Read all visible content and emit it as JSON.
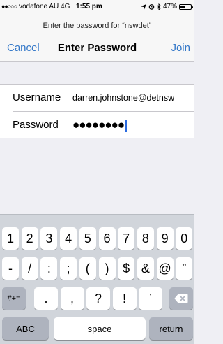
{
  "status": {
    "signal": "●●○○○",
    "carrier": "vodafone AU",
    "network": "4G",
    "time": "1:55 pm",
    "icons": [
      "location-arrow-icon",
      "alarm-icon",
      "bluetooth-icon"
    ],
    "battery_text": "47%",
    "battery_level": 0.47
  },
  "nav": {
    "prompt": "Enter the password for “nswdet”",
    "cancel": "Cancel",
    "title": "Enter Password",
    "join": "Join"
  },
  "form": {
    "username_label": "Username",
    "username_value": "darren.johnstone@detnsw",
    "password_label": "Password",
    "password_value": "●●●●●●●●"
  },
  "keyboard": {
    "row1": [
      "1",
      "2",
      "3",
      "4",
      "5",
      "6",
      "7",
      "8",
      "9",
      "0"
    ],
    "row2": [
      "-",
      "/",
      ":",
      ";",
      "(",
      ")",
      "$",
      "&",
      "@",
      "”"
    ],
    "row3_left": "#+=",
    "row3": [
      ".",
      ",",
      "?",
      "!",
      "’"
    ],
    "row3_right_icon": "backspace-icon",
    "row4": {
      "abc": "ABC",
      "space": "space",
      "return": "return"
    },
    "colors": {
      "background": "#d1d5db",
      "key": "#ffffff",
      "function_key": "#aeb3be"
    }
  },
  "colors": {
    "accent": "#3478c8",
    "caret": "#2a6be0"
  }
}
